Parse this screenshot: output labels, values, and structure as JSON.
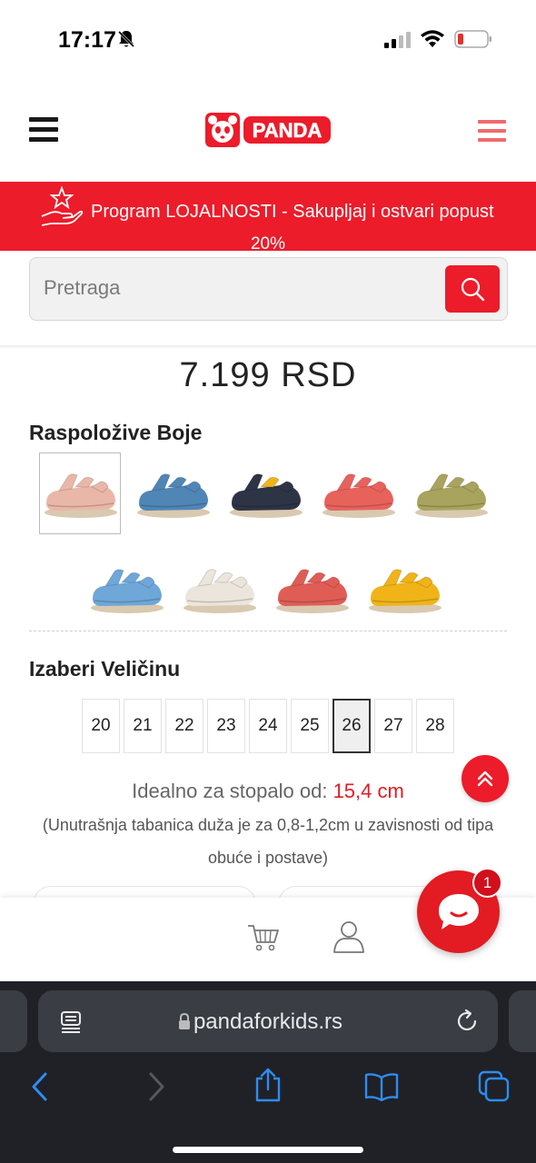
{
  "status_bar": {
    "time": "17:17",
    "icons": [
      "bell-slash-icon",
      "signal-icon",
      "wifi-icon",
      "battery-low-icon"
    ]
  },
  "header": {
    "logo_text": "PANDA",
    "left_icon": "hamburger-icon",
    "right_icon": "menu-icon"
  },
  "loyalty_banner": {
    "text": "Program LOJALNOSTI - Sakupljaj i ostvari popust",
    "text_continued": "20%"
  },
  "search": {
    "placeholder": "Pretraga",
    "button_icon": "search-icon"
  },
  "product": {
    "price": "7.199 RSD",
    "colors_title": "Raspoložive Boje",
    "colors": [
      {
        "name": "pink",
        "hex": "#e9b7a8",
        "selected": true
      },
      {
        "name": "blue",
        "hex": "#4f86b6",
        "selected": false
      },
      {
        "name": "navy-yellow",
        "hex": "#2d3446",
        "selected": false
      },
      {
        "name": "coral",
        "hex": "#e8625c",
        "selected": false
      },
      {
        "name": "olive",
        "hex": "#a8a45d",
        "selected": false
      },
      {
        "name": "light-blue",
        "hex": "#6ea7d8",
        "selected": false
      },
      {
        "name": "white-dots",
        "hex": "#ece5dc",
        "selected": false
      },
      {
        "name": "red",
        "hex": "#df5d55",
        "selected": false
      },
      {
        "name": "yellow",
        "hex": "#f0b419",
        "selected": false
      }
    ],
    "size_title": "Izaberi Veličinu",
    "sizes": [
      "20",
      "21",
      "22",
      "23",
      "24",
      "25",
      "26",
      "27",
      "28"
    ],
    "selected_size": "26",
    "fit_label": "Idealno za stopalo od:",
    "fit_value": "15,4 cm",
    "fit_note": "(Unutrašnja tabanica duža je za 0,8-1,2cm u zavisnosti od tipa obuće i postave)"
  },
  "chat": {
    "badge_count": "1"
  },
  "app_nav": {
    "items": [
      "cart-icon",
      "user-icon"
    ]
  },
  "browser": {
    "url": "pandaforkids.rs",
    "toolbar": [
      "back-icon",
      "forward-icon",
      "share-icon",
      "bookmarks-icon",
      "tabs-icon"
    ]
  },
  "colors": {
    "brand_red": "#ec1c2a",
    "browser_bg": "#1f2126"
  }
}
